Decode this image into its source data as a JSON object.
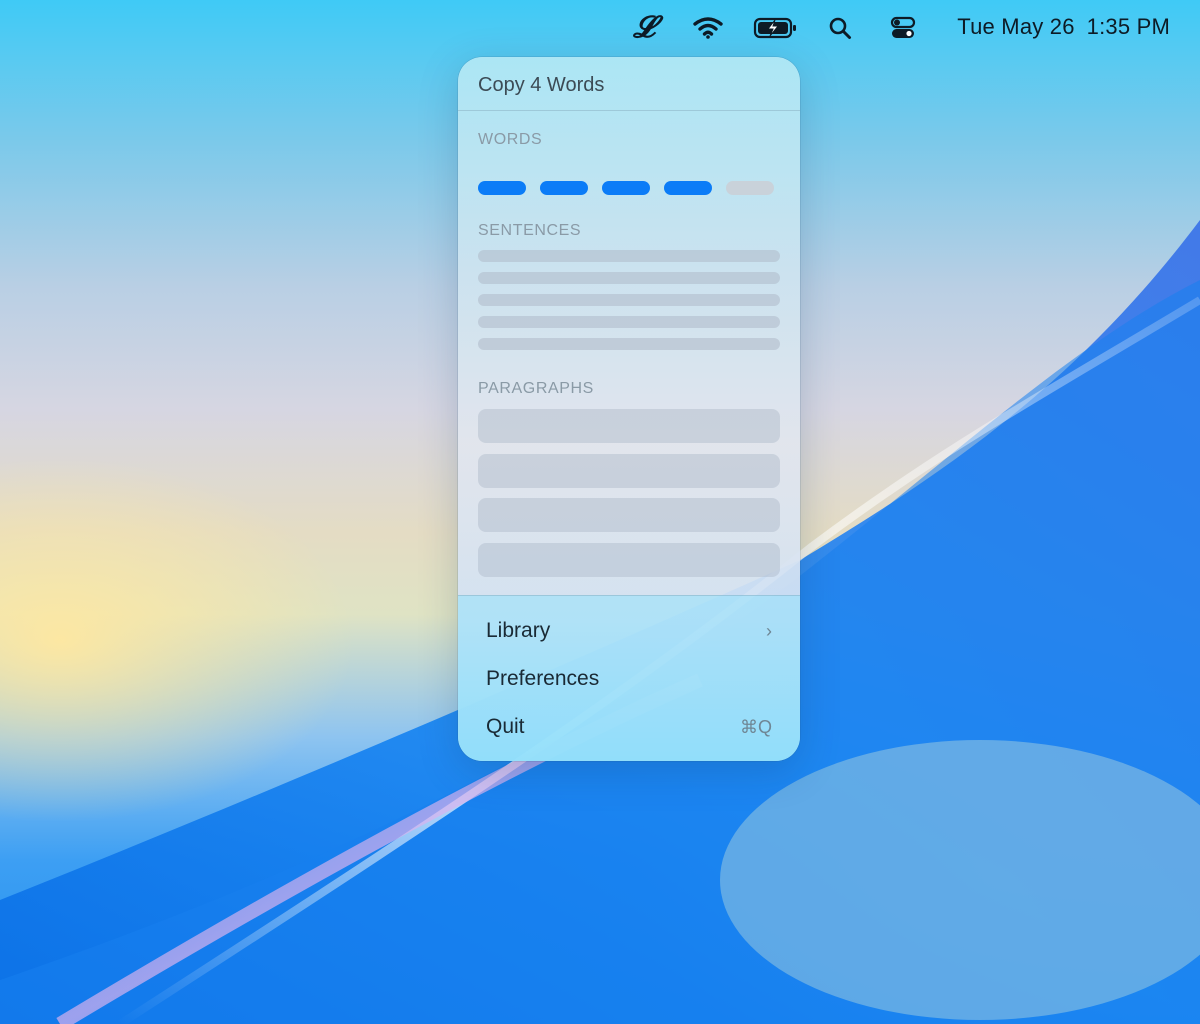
{
  "menubar": {
    "icons": [
      "script-l-icon",
      "wifi-icon",
      "battery-charging-icon",
      "search-icon",
      "control-center-icon"
    ],
    "app_glyph": "𝓛",
    "clock_date": "Tue May 26",
    "clock_time": "1:35 PM"
  },
  "popover": {
    "title": "Copy 4 Words",
    "sections": {
      "words": {
        "label": "WORDS",
        "total": 5,
        "selected": 4
      },
      "sentences": {
        "label": "SENTENCES",
        "count": 5
      },
      "paragraphs": {
        "label": "PARAGRAPHS",
        "count": 4
      }
    },
    "menu": [
      {
        "label": "Library",
        "accessory": "›"
      },
      {
        "label": "Preferences",
        "accessory": ""
      },
      {
        "label": "Quit",
        "accessory": "⌘Q"
      }
    ]
  },
  "colors": {
    "accent": "#0b7cf7",
    "inactive_bar": "#c9d2da"
  }
}
